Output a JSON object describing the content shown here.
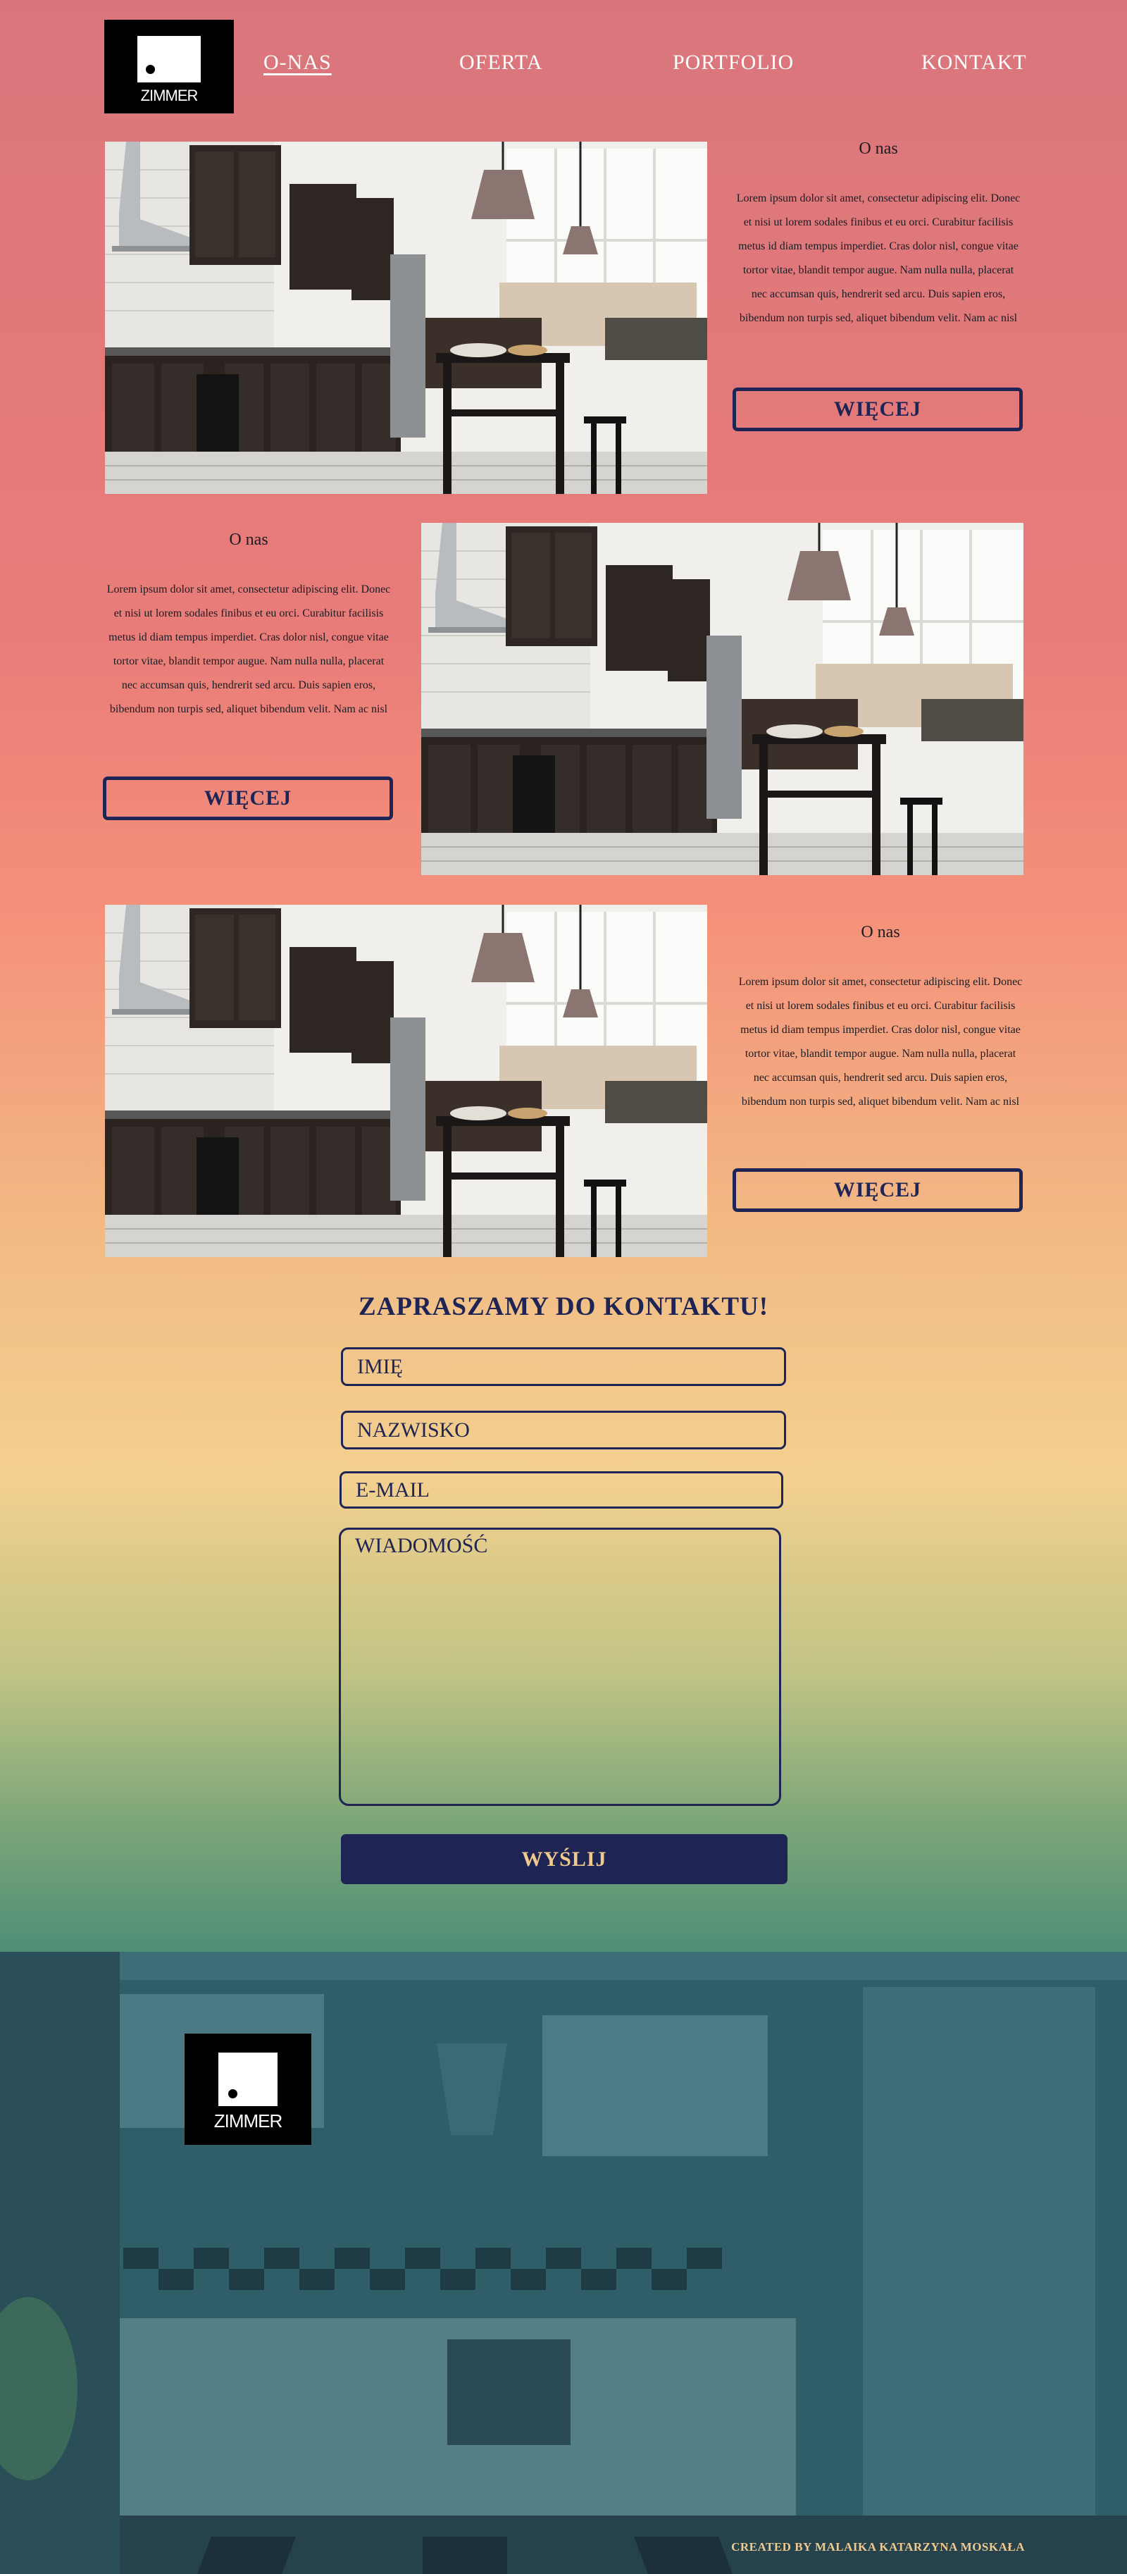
{
  "logo": {
    "text": "ZIMMER"
  },
  "nav": [
    {
      "label": "O-NAS",
      "active": true
    },
    {
      "label": "OFERTA",
      "active": false
    },
    {
      "label": "PORTFOLIO",
      "active": false
    },
    {
      "label": "KONTAKT",
      "active": false
    }
  ],
  "sections": [
    {
      "title": "O nas",
      "text": "Lorem ipsum dolor sit amet, consectetur adipiscing elit. Donec et nisi ut lorem sodales finibus et eu orci. Curabitur facilisis metus id diam tempus imperdiet. Cras dolor nisl, congue vitae tortor vitae, blandit tempor augue. Nam nulla nulla, placerat nec accumsan quis, hendrerit sed arcu. Duis sapien eros, bibendum non turpis sed, aliquet bibendum velit. Nam ac nisl",
      "button": "WIĘCEJ"
    },
    {
      "title": "O nas",
      "text": "Lorem ipsum dolor sit amet, consectetur adipiscing elit. Donec et nisi ut lorem sodales finibus et eu orci. Curabitur facilisis metus id diam tempus imperdiet. Cras dolor nisl, congue vitae tortor vitae, blandit tempor augue. Nam nulla nulla, placerat nec accumsan quis, hendrerit sed arcu. Duis sapien eros, bibendum non turpis sed, aliquet bibendum velit. Nam ac nisl",
      "button": "WIĘCEJ"
    },
    {
      "title": "O nas",
      "text": "Lorem ipsum dolor sit amet, consectetur adipiscing elit. Donec et nisi ut lorem sodales finibus et eu orci. Curabitur facilisis metus id diam tempus imperdiet. Cras dolor nisl, congue vitae tortor vitae, blandit tempor augue. Nam nulla nulla, placerat nec accumsan quis, hendrerit sed arcu. Duis sapien eros, bibendum non turpis sed, aliquet bibendum velit. Nam ac nisl",
      "button": "WIĘCEJ"
    }
  ],
  "contact": {
    "title": "ZAPRASZAMY DO KONTAKTU!",
    "placeholders": {
      "imie": "IMIĘ",
      "nazwisko": "NAZWISKO",
      "email": "E-MAIL",
      "wiadomosc": "WIADOMOŚĆ"
    },
    "submit": "WYŚLIJ"
  },
  "footer": {
    "credit": "CREATED BY MALAIKA KATARZYNA MOSKAŁA"
  },
  "colors": {
    "navy": "#1e2453",
    "gold": "#f0c98e",
    "coral": "#e97c79",
    "teal": "#2c5965"
  }
}
